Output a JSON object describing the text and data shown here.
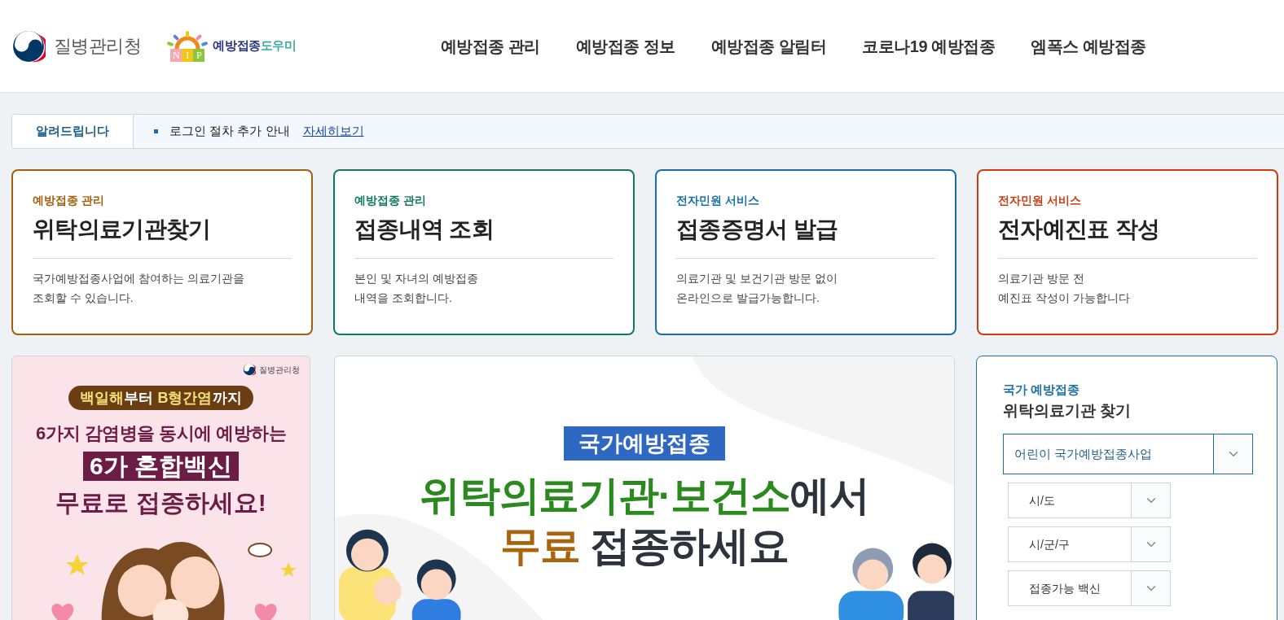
{
  "header": {
    "agency_logo": "질병관리청",
    "service_logo": {
      "badge": [
        "N",
        "I",
        "P"
      ],
      "name_main": "예방접종",
      "name_accent": "도우미"
    },
    "nav": [
      "예방접종 관리",
      "예방접종 정보",
      "예방접종 알림터",
      "코로나19 예방접종",
      "엠폭스 예방접종"
    ]
  },
  "notice": {
    "label": "알려드립니다",
    "item": "로그인 절차 추가 안내",
    "link": "자세히보기"
  },
  "cards": [
    {
      "category": "예방접종 관리",
      "title": "위탁의료기관찾기",
      "description": [
        "국가예방접종사업에 참여하는 의료기관을",
        "조회할 수 있습니다."
      ],
      "color": "#a35f0a"
    },
    {
      "category": "예방접종 관리",
      "title": "접종내역 조회",
      "description": [
        "본인 및 자녀의 예방접종",
        "내역을 조회합니다."
      ],
      "color": "#0e7a5e"
    },
    {
      "category": "전자민원 서비스",
      "title": "접종증명서 발급",
      "description": [
        "의료기관 및 보건기관 방문 없이",
        "온라인으로 발급가능합니다."
      ],
      "color": "#166fa6"
    },
    {
      "category": "전자민원 서비스",
      "title": "전자예진표 작성",
      "description": [
        "의료기관 방문 전",
        "예진표 작성이 가능합니다"
      ],
      "color": "#cf3b0c"
    }
  ],
  "left_banner": {
    "logo": "질병관리청",
    "pill": [
      {
        "text": "백일해",
        "color": "#f6e27a"
      },
      {
        "text": "부터 ",
        "color": "#ffffff"
      },
      {
        "text": "B형간염",
        "color": "#f6e27a"
      },
      {
        "text": "까지",
        "color": "#ffffff"
      }
    ],
    "line1": "6가지 감염병을 동시에 예방하는",
    "highlight": "6가 혼합백신",
    "line2": "무료로 접종하세요!"
  },
  "main_banner": {
    "badge": "국가예방접종",
    "headline1": [
      {
        "text": "위탁의료기관·보건소",
        "color": "#2a8a1e"
      },
      {
        "text": "에서",
        "color": "#2d333d"
      }
    ],
    "headline2": [
      {
        "text": "무료",
        "color": "#a8650b"
      },
      {
        "text": " 접종하세요",
        "color": "#2d333d"
      }
    ]
  },
  "finder": {
    "subtitle": "국가 예방접종",
    "title": "위탁의료기관 찾기",
    "selects": [
      {
        "kind": "primary",
        "value": "어린이 국가예방접종사업"
      },
      {
        "kind": "secondary",
        "value": "시/도"
      },
      {
        "kind": "secondary",
        "value": "시/군/구"
      },
      {
        "kind": "secondary",
        "value": "접종가능 백신"
      }
    ]
  }
}
